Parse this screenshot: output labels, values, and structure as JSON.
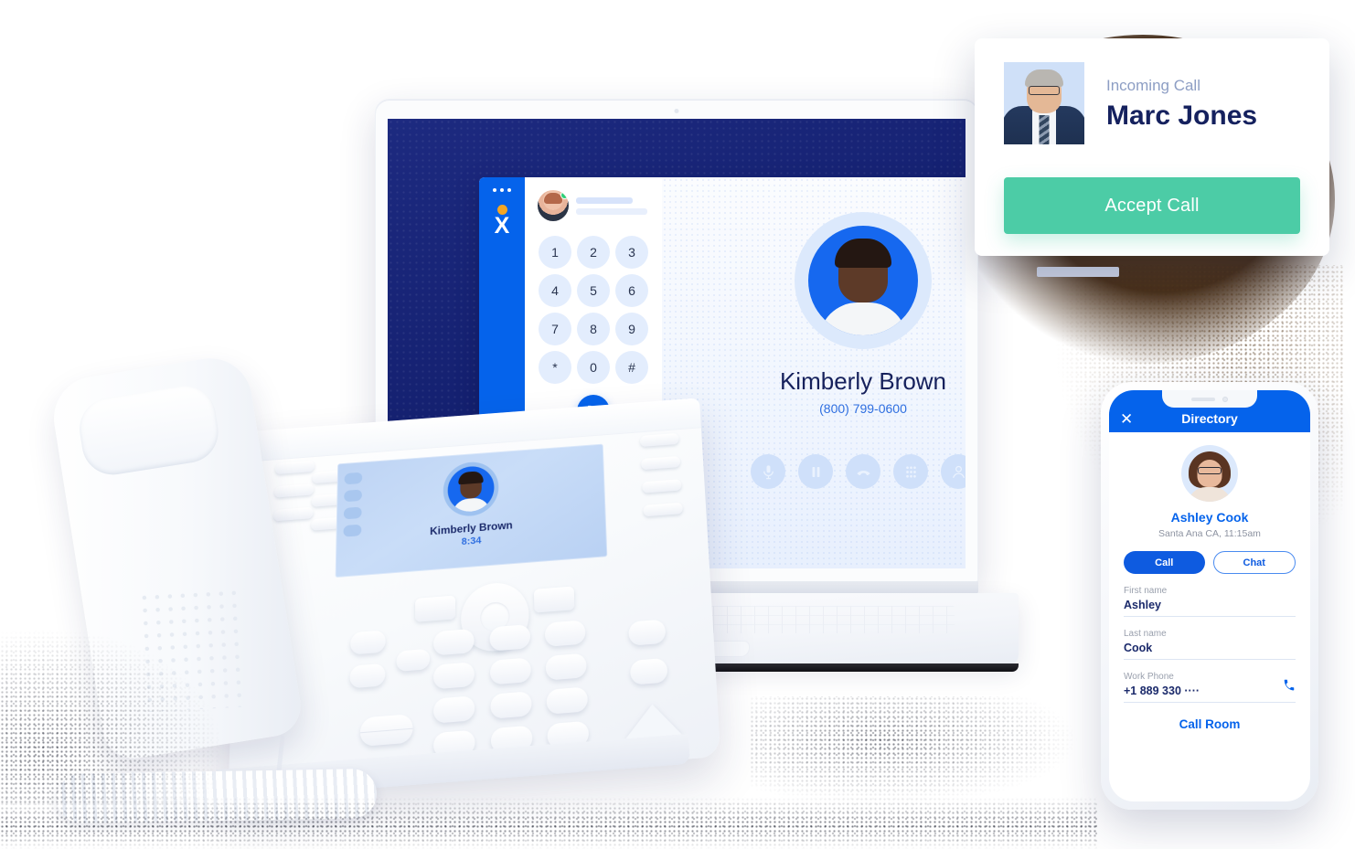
{
  "scene": {
    "title": "Unified communications product montage",
    "colors": {
      "brand_blue": "#0563EB",
      "deep_navy": "#1D2A80",
      "accept_green": "#4CCCA6",
      "logo_orange": "#F5A623",
      "text_navy": "#15215E",
      "muted_blue": "#8D9EC4"
    }
  },
  "incoming_call_card": {
    "label": "Incoming Call",
    "caller_name": "Marc Jones",
    "accept_label": "Accept Call",
    "avatar_alt": "marc-jones-photo"
  },
  "laptop_app": {
    "logo_letter": "X",
    "rail_menu_icon": "more-dots-icon",
    "dialpad_keys": [
      "1",
      "2",
      "3",
      "4",
      "5",
      "6",
      "7",
      "8",
      "9",
      "*",
      "0",
      "#"
    ],
    "call_button_icon": "phone-icon",
    "active_call": {
      "name": "Kimberly Brown",
      "number": "(800) 799-0600",
      "avatar_alt": "kimberly-brown-avatar"
    },
    "call_controls": [
      {
        "name": "mute-icon",
        "label": "Mute"
      },
      {
        "name": "hold-icon",
        "label": "Hold"
      },
      {
        "name": "hangup-icon",
        "label": "Hang up"
      },
      {
        "name": "keypad-icon",
        "label": "Keypad"
      },
      {
        "name": "contacts-icon",
        "label": "Contacts"
      }
    ]
  },
  "desk_phone": {
    "screen": {
      "caller_name": "Kimberly Brown",
      "call_timer": "8:34",
      "avatar_alt": "kimberly-brown-avatar"
    }
  },
  "mobile_app": {
    "close_icon": "close-icon",
    "title": "Directory",
    "contact": {
      "name": "Ashley Cook",
      "location_time": "Santa Ana CA, 11:15am",
      "avatar_alt": "ashley-cook-avatar"
    },
    "actions": {
      "call_label": "Call",
      "chat_label": "Chat"
    },
    "fields": [
      {
        "label": "First name",
        "value": "Ashley"
      },
      {
        "label": "Last name",
        "value": "Cook"
      },
      {
        "label": "Work Phone",
        "value": "+1 889 330 ····",
        "icon": "phone-icon"
      }
    ],
    "footer_link": "Call Room"
  }
}
